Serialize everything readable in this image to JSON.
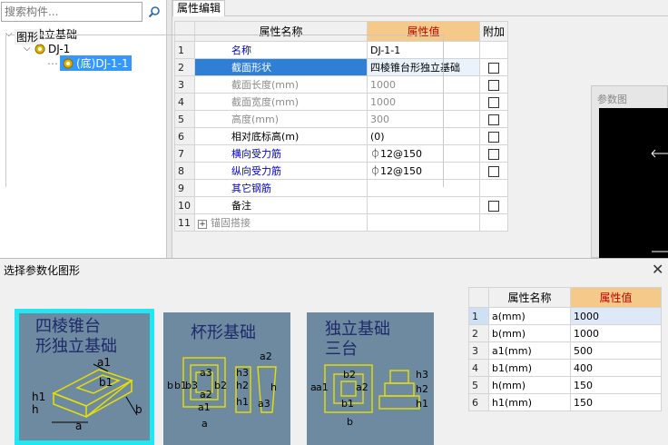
{
  "search": {
    "placeholder": "搜索构件..."
  },
  "tree": {
    "root": "独立基础",
    "child": "DJ-1",
    "leaf": "(底)DJ-1-1"
  },
  "tab": "属性编辑",
  "grid": {
    "headers": [
      "属性名称",
      "属性值",
      "附加"
    ],
    "rows": [
      {
        "n": "1",
        "name": "名称",
        "value": "DJ-1-1"
      },
      {
        "n": "2",
        "name": "截面形状",
        "value": "四棱锥台形独立基础"
      },
      {
        "n": "3",
        "name": "截面长度(mm)",
        "value": "1000"
      },
      {
        "n": "4",
        "name": "截面宽度(mm)",
        "value": "1000"
      },
      {
        "n": "5",
        "name": "高度(mm)",
        "value": "300"
      },
      {
        "n": "6",
        "name": "相对底标高(m)",
        "value": "(0)"
      },
      {
        "n": "7",
        "name": "横向受力筋",
        "value": "⏀12@150"
      },
      {
        "n": "8",
        "name": "纵向受力筋",
        "value": "⏀12@150"
      },
      {
        "n": "9",
        "name": "其它钢筋",
        "value": ""
      },
      {
        "n": "10",
        "name": "备注",
        "value": ""
      },
      {
        "n": "11",
        "name": "锚固搭接",
        "value": ""
      }
    ]
  },
  "param_panel": {
    "title": "参数图"
  },
  "dialog": {
    "title": "选择参数化图形",
    "group_label": "图形",
    "thumb1": {
      "line1": "四棱锥台",
      "line2": "形独立基础",
      "labels": [
        "a1",
        "b1",
        "h1",
        "h",
        "a",
        "b"
      ]
    },
    "thumb2": {
      "title": "杯形基础",
      "labels": [
        "a2",
        "b",
        "b1",
        "b3",
        "a3",
        "b2",
        "a2",
        "a1",
        "a",
        "h3",
        "h2",
        "h1",
        "h",
        "a3"
      ]
    },
    "thumb3": {
      "line1": "独立基础",
      "line2": "三台",
      "labels": [
        "a",
        "a1",
        "b2",
        "a2",
        "b1",
        "b",
        "h3",
        "h2",
        "h1"
      ]
    }
  },
  "params": {
    "headers": [
      "属性名称",
      "属性值"
    ],
    "rows": [
      {
        "n": "1",
        "name": "a(mm)",
        "value": "1000"
      },
      {
        "n": "2",
        "name": "b(mm)",
        "value": "1000"
      },
      {
        "n": "3",
        "name": "a1(mm)",
        "value": "500"
      },
      {
        "n": "4",
        "name": "b1(mm)",
        "value": "400"
      },
      {
        "n": "5",
        "name": "h(mm)",
        "value": "150"
      },
      {
        "n": "6",
        "name": "h1(mm)",
        "value": "150"
      }
    ]
  },
  "colors": {
    "selection": "#3399ff",
    "header_highlight": "#f5c98a",
    "thumb_bg": "#6e8aa0",
    "thumb_selected_border": "#1fe8f2",
    "diagram_yellow": "#e8e000"
  },
  "icons": [
    "search-icon",
    "foundation-icon",
    "gear-icon",
    "close-icon",
    "expand-icon"
  ]
}
